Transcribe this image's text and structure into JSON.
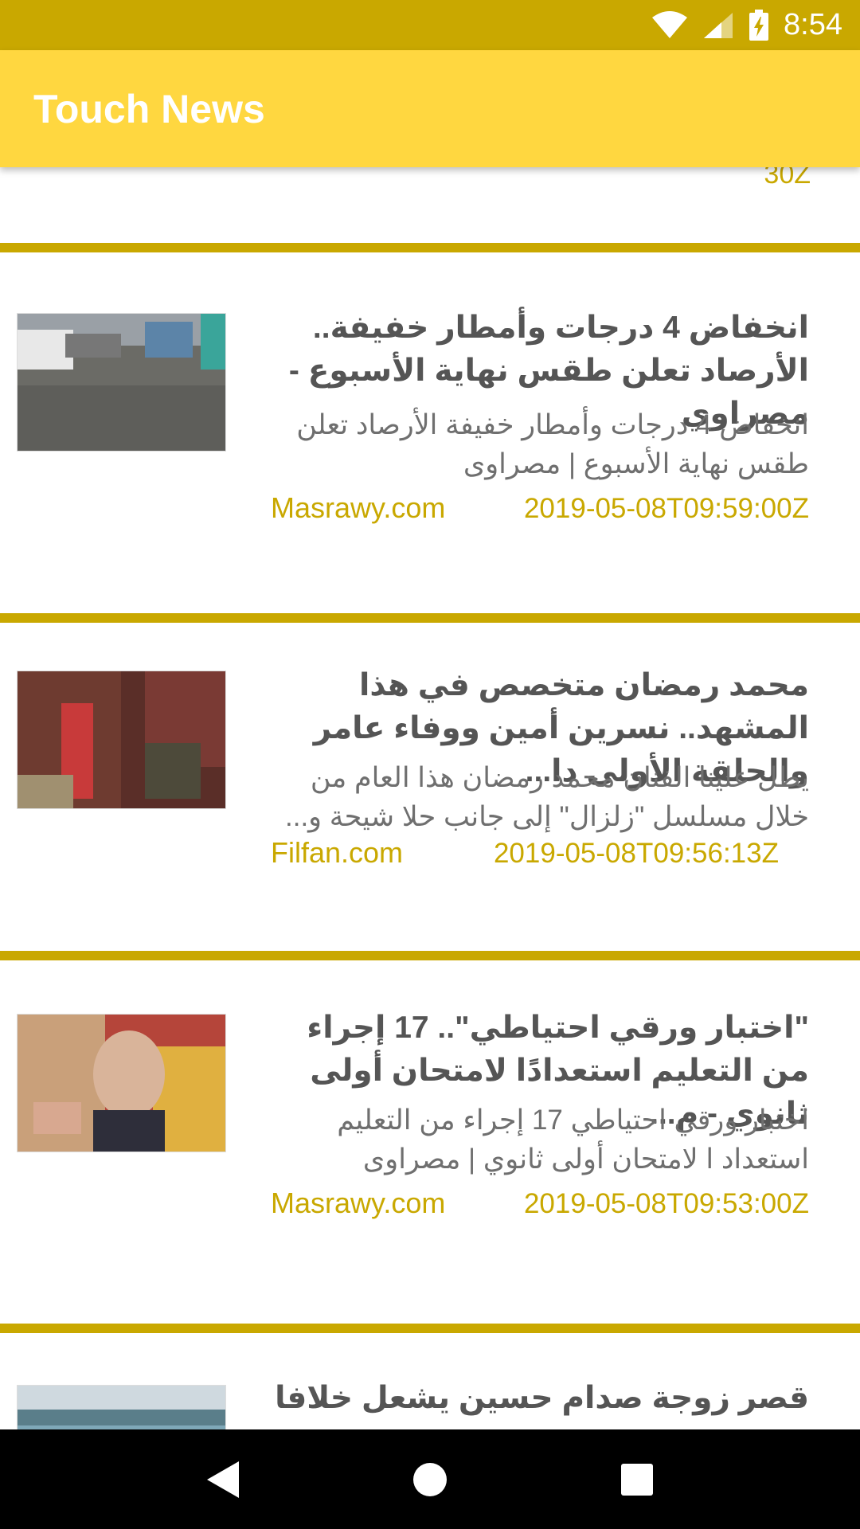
{
  "status_bar": {
    "time": "8:54",
    "bg": "#C9A800"
  },
  "app_bar": {
    "title": "Touch News",
    "bg": "#FFD740"
  },
  "feed": {
    "partial_date": "30Z",
    "articles": [
      {
        "headline": "انخفاض 4 درجات وأمطار خفيفة.. الأرصاد تعلن طقس نهاية الأسبوع - مصراوي",
        "summary": "انخفاض 4 درجات وأمطار خفيفة الأرصاد تعلن طقس نهاية الأسبوع | مصراوى",
        "source": "Masrawy.com",
        "date": "2019-05-08T09:59:00Z"
      },
      {
        "headline": "محمد رمضان متخصص في هذا المشهد.. نسرين أمين ووفاء عامر والحلقة الأولى دا...",
        "summary": "يطل علينا الفنان محمد رمضان هذا العام من خلال مسلسل \"زلزال\" إلى جانب حلا شيحة و...",
        "source": "Filfan.com",
        "date": "2019-05-08T09:56:13Z"
      },
      {
        "headline": "\"اختبار ورقي احتياطي\".. 17 إجراء من التعليم استعدادًا لامتحان أولى ثانوي - م...",
        "summary": "اختبار ورقي احتياطي 17 إجراء من التعليم استعداد ا لامتحان أولى ثانوي | مصراوى",
        "source": "Masrawy.com",
        "date": "2019-05-08T09:53:00Z"
      },
      {
        "headline": "قصر زوجة صدام حسين يشعل خلافا",
        "summary": "",
        "source": "",
        "date": ""
      }
    ]
  },
  "nav_bar": {
    "back": "back-icon",
    "home": "home-icon",
    "recents": "recents-icon"
  },
  "colors": {
    "accent": "#C9A800",
    "primary": "#FFD740",
    "headline": "#555555",
    "summary": "#6f6f6f"
  }
}
